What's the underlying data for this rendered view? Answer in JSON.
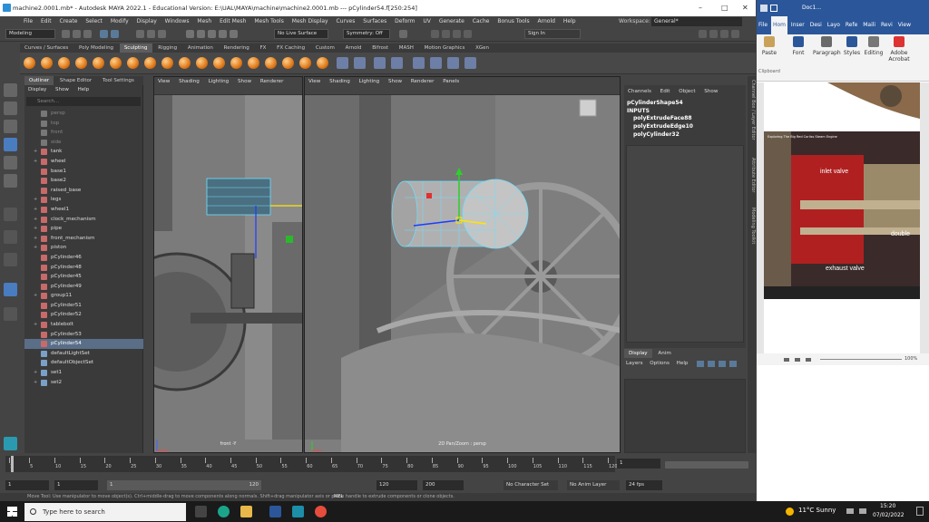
{
  "maya": {
    "title": "machine2.0001.mb* - Autodesk MAYA 2022.1 - Educational Version: E:\\UAL\\MAYA\\machine\\machine2.0001.mb  ---  pCylinder54.f[250:254]",
    "menu": [
      "File",
      "Edit",
      "Create",
      "Select",
      "Modify",
      "Display",
      "Windows",
      "Mesh",
      "Edit Mesh",
      "Mesh Tools",
      "Mesh Display",
      "Curves",
      "Surfaces",
      "Deform",
      "UV",
      "Generate",
      "Cache",
      "Bonus Tools",
      "Arnold",
      "Help"
    ],
    "workspace_label": "Workspace:",
    "workspace_value": "General*",
    "mode_value": "Modeling",
    "live_surface": "No Live Surface",
    "symmetry": "Symmetry: Off",
    "sign_in": "Sign In",
    "shelf_tabs": [
      "Curves / Surfaces",
      "Poly Modeling",
      "Sculpting",
      "Rigging",
      "Animation",
      "Rendering",
      "FX",
      "FX Caching",
      "Custom",
      "Arnold",
      "Bifrost",
      "MASH",
      "Motion Graphics",
      "XGen"
    ],
    "shelf_active": "Sculpting",
    "outliner": {
      "tabs": [
        "Outliner",
        "Shape Editor",
        "Tool Settings"
      ],
      "menu": [
        "Display",
        "Show",
        "Help"
      ],
      "search_placeholder": "Search...",
      "items": [
        {
          "label": "persp",
          "dim": true,
          "exp": false
        },
        {
          "label": "top",
          "dim": true,
          "exp": false
        },
        {
          "label": "front",
          "dim": true,
          "exp": false
        },
        {
          "label": "side",
          "dim": true,
          "exp": false
        },
        {
          "label": "tank",
          "dim": false,
          "exp": true
        },
        {
          "label": "wheel",
          "dim": false,
          "exp": true
        },
        {
          "label": "base1",
          "dim": false,
          "exp": false
        },
        {
          "label": "base2",
          "dim": false,
          "exp": false
        },
        {
          "label": "raised_base",
          "dim": false,
          "exp": false
        },
        {
          "label": "legs",
          "dim": false,
          "exp": true
        },
        {
          "label": "wheel1",
          "dim": false,
          "exp": true
        },
        {
          "label": "clock_mechanism",
          "dim": false,
          "exp": true
        },
        {
          "label": "pipe",
          "dim": false,
          "exp": true
        },
        {
          "label": "front_mechanism",
          "dim": false,
          "exp": true
        },
        {
          "label": "piston",
          "dim": false,
          "exp": true
        },
        {
          "label": "pCylinder46",
          "dim": false,
          "exp": false
        },
        {
          "label": "pCylinder48",
          "dim": false,
          "exp": false
        },
        {
          "label": "pCylinder45",
          "dim": false,
          "exp": false
        },
        {
          "label": "pCylinder49",
          "dim": false,
          "exp": false
        },
        {
          "label": "group11",
          "dim": false,
          "exp": true
        },
        {
          "label": "pCylinder51",
          "dim": false,
          "exp": false
        },
        {
          "label": "pCylinder52",
          "dim": false,
          "exp": false
        },
        {
          "label": "tablebolt",
          "dim": false,
          "exp": true
        },
        {
          "label": "pCylinder53",
          "dim": false,
          "exp": false
        },
        {
          "label": "pCylinder54",
          "dim": false,
          "exp": false,
          "selected": true
        },
        {
          "label": "defaultLightSet",
          "dim": false,
          "exp": false
        },
        {
          "label": "defaultObjectSet",
          "dim": false,
          "exp": false
        },
        {
          "label": "set1",
          "dim": false,
          "exp": true
        },
        {
          "label": "set2",
          "dim": false,
          "exp": true
        }
      ]
    },
    "panel_menu": [
      "View",
      "Shading",
      "Lighting",
      "Show",
      "Renderer"
    ],
    "panel2_menu": [
      "View",
      "Shading",
      "Lighting",
      "Show",
      "Renderer",
      "Panels"
    ],
    "front_label": "front -Y",
    "persp_label": "2D Pan/Zoom : persp",
    "channel_box": {
      "menu": [
        "Channels",
        "Edit",
        "Object",
        "Show"
      ],
      "shape_name": "pCylinderShape54",
      "inputs_label": "INPUTS",
      "inputs": [
        "polyExtrudeFace88",
        "polyExtrudeEdge10",
        "polyCylinder32"
      ]
    },
    "layer_tabs": [
      "Display",
      "Anim"
    ],
    "layer_menu": [
      "Layers",
      "Options",
      "Help"
    ],
    "side_tabs": [
      "Channel Box / Layer Editor",
      "Attribute Editor",
      "Modeling Toolkit"
    ],
    "timeline_ticks": [
      "1",
      "5",
      "10",
      "15",
      "20",
      "25",
      "30",
      "35",
      "40",
      "45",
      "50",
      "55",
      "60",
      "65",
      "70",
      "75",
      "80",
      "85",
      "90",
      "95",
      "100",
      "105",
      "110",
      "115",
      "120"
    ],
    "current_frame": "1",
    "range": {
      "start": "1",
      "start2": "1",
      "inner_start": "1",
      "inner_end": "120",
      "end": "120",
      "end2": "200",
      "char_set": "No Character Set",
      "anim_layer": "No Anim Layer",
      "fps": "24 fps"
    },
    "cmd_label": "MEL",
    "help_line": "Move Tool: Use manipulator to move object(s). Ctrl+middle-drag to move components along normals. Shift+drag manipulator axis or plane handle to extrude components or clone objects."
  },
  "word": {
    "title": "Doc1...",
    "tabs": [
      "File",
      "Home",
      "Insert",
      "Design",
      "Layout",
      "References",
      "Mailings",
      "Review",
      "View"
    ],
    "tabs_short": [
      "File",
      "Hom",
      "Inser",
      "Desi",
      "Layo",
      "Refe",
      "Maili",
      "Revi",
      "View"
    ],
    "ribbon": [
      "Paste",
      "Font",
      "Paragraph",
      "Styles",
      "Editing",
      "Adobe Acrobat"
    ],
    "clipboard_label": "Clipboard",
    "image_caption": "Exploring The Big Red Corliss Steam Engine",
    "labels": [
      "inlet valve",
      "double",
      "exhaust valve"
    ],
    "zoom": "100%"
  },
  "taskbar": {
    "search_placeholder": "Type here to search",
    "weather": "11°C  Sunny",
    "time": "15:20",
    "date": "07/02/2022"
  }
}
